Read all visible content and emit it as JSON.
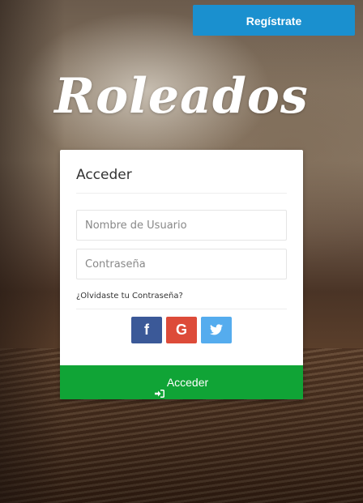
{
  "header": {
    "register_label": "Regístrate"
  },
  "brand": {
    "name": "Roleados"
  },
  "login": {
    "title": "Acceder",
    "username_placeholder": "Nombre de Usuario",
    "password_placeholder": "Contraseña",
    "forgot_label": "¿Olvidaste tu Contraseña?",
    "social": {
      "facebook_glyph": "f",
      "google_glyph": "G",
      "twitter_icon": "twitter-bird-icon"
    },
    "submit_label": "Acceder",
    "submit_icon": "sign-in-icon"
  },
  "colors": {
    "register": "#1a90cf",
    "facebook": "#3b5998",
    "google": "#dd4b39",
    "twitter": "#55acee",
    "submit": "#10a436"
  }
}
